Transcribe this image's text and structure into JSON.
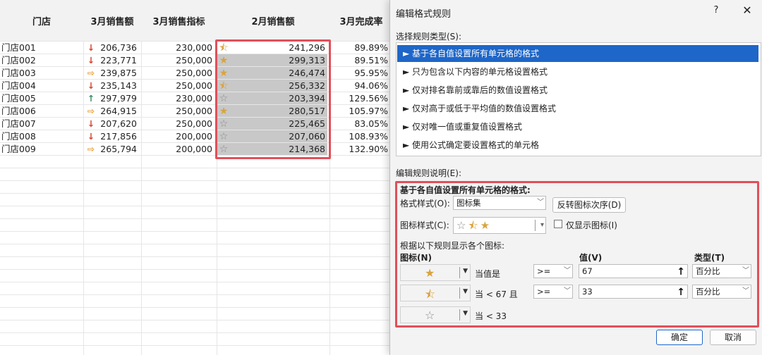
{
  "sheet": {
    "headers": [
      "门店",
      "3月销售额",
      "3月销售指标",
      "2月销售额",
      "3月完成率"
    ],
    "rows": [
      {
        "store": "门店001",
        "arrow": "down",
        "sales": "206,736",
        "target": "230,000",
        "star": "half",
        "feb": "241,296",
        "rate": "89.89%"
      },
      {
        "store": "门店002",
        "arrow": "down",
        "sales": "223,771",
        "target": "250,000",
        "star": "full",
        "feb": "299,313",
        "rate": "89.51%"
      },
      {
        "store": "门店003",
        "arrow": "right",
        "sales": "239,875",
        "target": "250,000",
        "star": "full",
        "feb": "246,474",
        "rate": "95.95%"
      },
      {
        "store": "门店004",
        "arrow": "down",
        "sales": "235,143",
        "target": "250,000",
        "star": "half",
        "feb": "256,332",
        "rate": "94.06%"
      },
      {
        "store": "门店005",
        "arrow": "up",
        "sales": "297,979",
        "target": "230,000",
        "star": "empty",
        "feb": "203,394",
        "rate": "129.56%"
      },
      {
        "store": "门店006",
        "arrow": "right",
        "sales": "264,915",
        "target": "250,000",
        "star": "full",
        "feb": "280,517",
        "rate": "105.97%"
      },
      {
        "store": "门店007",
        "arrow": "down",
        "sales": "207,620",
        "target": "250,000",
        "star": "empty",
        "feb": "225,465",
        "rate": "83.05%"
      },
      {
        "store": "门店008",
        "arrow": "down",
        "sales": "217,856",
        "target": "200,000",
        "star": "empty",
        "feb": "207,060",
        "rate": "108.93%"
      },
      {
        "store": "门店009",
        "arrow": "right",
        "sales": "265,794",
        "target": "200,000",
        "star": "empty",
        "feb": "214,368",
        "rate": "132.90%"
      }
    ]
  },
  "dialog": {
    "title": "编辑格式规则",
    "help": "?",
    "close": "✕",
    "rule_type_label": "选择规则类型(S):",
    "rule_types": [
      "► 基于各自值设置所有单元格的格式",
      "► 只为包含以下内容的单元格设置格式",
      "► 仅对排名靠前或靠后的数值设置格式",
      "► 仅对高于或低于平均值的数值设置格式",
      "► 仅对唯一值或重复值设置格式",
      "► 使用公式确定要设置格式的单元格"
    ],
    "selected_rule_index": 0,
    "edit_desc_label": "编辑规则说明(E):",
    "desc_heading": "基于各自值设置所有单元格的格式:",
    "format_style_label": "格式样式(O):",
    "format_style_value": "图标集",
    "reverse_button": "反转图标次序(D)",
    "icon_style_label": "图标样式(C):",
    "show_icon_only_label": "仅显示图标(I)",
    "show_icon_only_checked": false,
    "rules_caption": "根据以下规则显示各个图标:",
    "col_icon": "图标(N)",
    "col_value": "值(V)",
    "col_type": "类型(T)",
    "icon_rules": [
      {
        "icon": "full-star",
        "condition": "当值是",
        "op": ">=",
        "value": "67",
        "type": "百分比"
      },
      {
        "icon": "half-star",
        "condition": "当 < 67 且",
        "op": ">=",
        "value": "33",
        "type": "百分比"
      },
      {
        "icon": "empty-star",
        "condition": "当 < 33",
        "op": "",
        "value": "",
        "type": ""
      }
    ],
    "ok_button": "确定",
    "cancel_button": "取消"
  },
  "colors": {
    "highlight_border": "#e0505a",
    "selection_blue": "#1e66c8",
    "star_gold": "#d9a33f",
    "arrow_red": "#d9452f",
    "arrow_green": "#3e8f6b",
    "arrow_orange": "#e8a13c"
  }
}
